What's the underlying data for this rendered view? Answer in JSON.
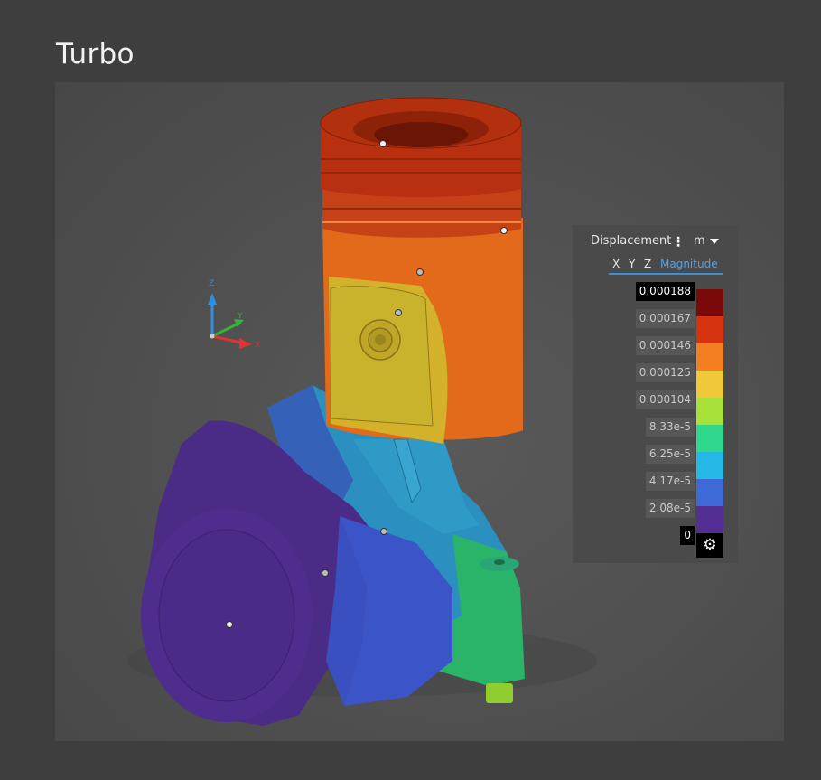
{
  "page": {
    "title": "Turbo"
  },
  "axes_triad": {
    "x_label": "X",
    "y_label": "Y",
    "z_label": "Z"
  },
  "legend": {
    "quantity": "Displacement",
    "menu_icon": "⋮",
    "unit": "m",
    "components": [
      "X",
      "Y",
      "Z",
      "Magnitude"
    ],
    "active_component": "Magnitude",
    "scale_labels": [
      "0.000188",
      "0.000167",
      "0.000146",
      "0.000125",
      "0.000104",
      "8.33e-5",
      "6.25e-5",
      "4.17e-5",
      "2.08e-5",
      "0"
    ],
    "colors": [
      "#7a0a0a",
      "#d5320f",
      "#f47f22",
      "#efc93a",
      "#a7e13a",
      "#2fd88c",
      "#25b8e6",
      "#3d6ad6",
      "#542f93"
    ],
    "settings_icon": "gear-icon"
  }
}
